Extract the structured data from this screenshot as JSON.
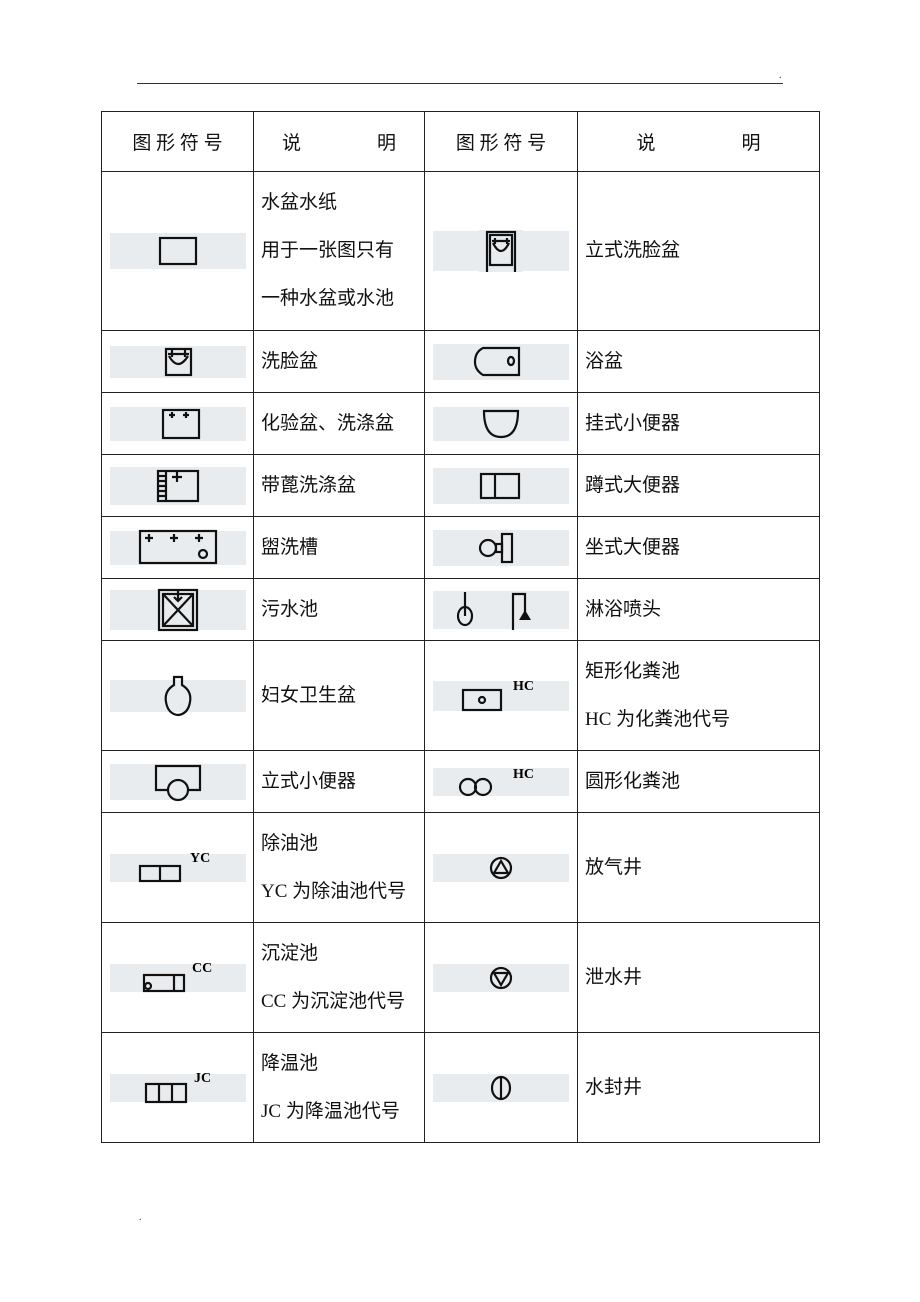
{
  "header": {
    "col1": "图 形 符 号",
    "col2_a": "说",
    "col2_b": "明",
    "col3": "图 形 符 号",
    "col4_a": "说",
    "col4_b": "明"
  },
  "page_marks": {
    "top_right": ".",
    "bottom_left": "."
  },
  "rows": [
    {
      "left": {
        "symbol": "sink-generic-icon",
        "lines": [
          "水盆水纸",
          "用于一张图只有",
          "一种水盆或水池"
        ]
      },
      "right": {
        "symbol": "pedestal-washbasin-icon",
        "lines": [
          "立式洗脸盆"
        ]
      }
    },
    {
      "left": {
        "symbol": "washbasin-icon",
        "lines": [
          "洗脸盆"
        ]
      },
      "right": {
        "symbol": "bathtub-icon",
        "lines": [
          "浴盆"
        ]
      }
    },
    {
      "left": {
        "symbol": "lab-sink-icon",
        "lines": [
          "化验盆、洗涤盆"
        ]
      },
      "right": {
        "symbol": "wall-urinal-icon",
        "lines": [
          "挂式小便器"
        ]
      }
    },
    {
      "left": {
        "symbol": "sink-with-drainboard-icon",
        "lines": [
          "带蓖洗涤盆"
        ]
      },
      "right": {
        "symbol": "squat-toilet-icon",
        "lines": [
          "蹲式大便器"
        ]
      }
    },
    {
      "left": {
        "symbol": "wash-trough-icon",
        "lines": [
          "盥洗槽"
        ]
      },
      "right": {
        "symbol": "seat-toilet-icon",
        "lines": [
          "坐式大便器"
        ]
      }
    },
    {
      "left": {
        "symbol": "sewage-sink-icon",
        "lines": [
          "污水池"
        ]
      },
      "right": {
        "symbol": "shower-head-icon",
        "lines": [
          "淋浴喷头"
        ]
      }
    },
    {
      "left": {
        "symbol": "bidet-icon",
        "lines": [
          "妇女卫生盆"
        ]
      },
      "right": {
        "symbol": "rect-septic-tank-icon",
        "code": "HC",
        "lines": [
          "矩形化粪池",
          "HC 为化粪池代号"
        ]
      }
    },
    {
      "left": {
        "symbol": "standing-urinal-icon",
        "lines": [
          "立式小便器"
        ]
      },
      "right": {
        "symbol": "round-septic-tank-icon",
        "code": "HC",
        "lines": [
          "圆形化粪池"
        ]
      }
    },
    {
      "left": {
        "symbol": "grease-trap-icon",
        "code": "YC",
        "lines": [
          "除油池",
          "YC 为除油池代号"
        ]
      },
      "right": {
        "symbol": "vent-well-icon",
        "lines": [
          "放气井"
        ]
      }
    },
    {
      "left": {
        "symbol": "settling-tank-icon",
        "code": "CC",
        "lines": [
          "沉淀池",
          "CC 为沉淀池代号"
        ]
      },
      "right": {
        "symbol": "drain-well-icon",
        "lines": [
          "泄水井"
        ]
      }
    },
    {
      "left": {
        "symbol": "cooling-tank-icon",
        "code": "JC",
        "lines": [
          "降温池",
          "JC 为降温池代号"
        ]
      },
      "right": {
        "symbol": "water-seal-well-icon",
        "lines": [
          "水封井"
        ]
      }
    }
  ],
  "colors": {
    "symbol_band": "#e9ecef",
    "line": "#222222"
  }
}
